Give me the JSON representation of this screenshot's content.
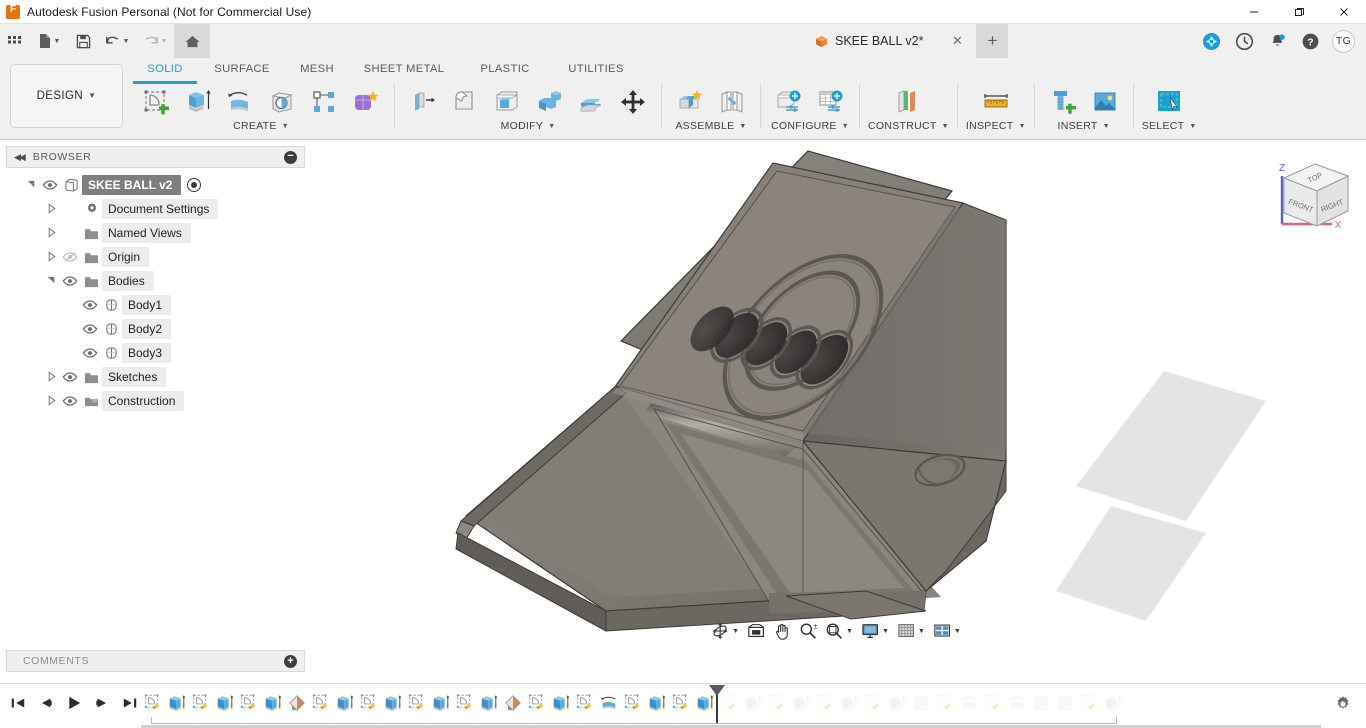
{
  "window": {
    "title": "Autodesk Fusion Personal (Not for Commercial Use)",
    "logo_icon": "fusion-logo-icon",
    "minimize_label": "—",
    "maximize_label": "❐",
    "close_label": "✕"
  },
  "quick_access": {
    "items": [
      {
        "name": "app-grid-button",
        "icon": "grid-icon"
      },
      {
        "name": "new-file-button",
        "icon": "file-icon",
        "has_caret": true
      },
      {
        "name": "save-button",
        "icon": "floppy-disk-icon"
      },
      {
        "name": "undo-button",
        "icon": "undo-arrow-icon",
        "has_caret": true
      },
      {
        "name": "redo-button",
        "icon": "redo-arrow-icon",
        "has_caret": true
      },
      {
        "name": "home-button",
        "icon": "home-icon"
      }
    ]
  },
  "document_tab": {
    "label": "SKEE BALL v2*",
    "icon": "orange-cube-icon",
    "close_label": "✕",
    "new_tab_label": "+"
  },
  "top_right": {
    "icons": [
      {
        "name": "extensions-icon",
        "glyph": "+",
        "color": "#1a9fd9"
      },
      {
        "name": "job-status-clock-icon",
        "glyph": "◴",
        "color": "#4d4d4d"
      },
      {
        "name": "notifications-bell-icon",
        "glyph": "🔔",
        "color": "#4d4d4d",
        "badge": true
      },
      {
        "name": "help-icon",
        "glyph": "?",
        "color": "#4d4d4d"
      }
    ],
    "avatar_initials": "TG"
  },
  "ribbon": {
    "workspace_label": "DESIGN",
    "workspace_caret": "▾",
    "tabs": [
      {
        "label": "SOLID",
        "active": true
      },
      {
        "label": "SURFACE",
        "active": false
      },
      {
        "label": "MESH",
        "active": false
      },
      {
        "label": "SHEET METAL",
        "active": false
      },
      {
        "label": "PLASTIC",
        "active": false
      },
      {
        "label": "UTILITIES",
        "active": false
      }
    ],
    "panels": [
      {
        "label": "CREATE",
        "has_caret": true,
        "tools": [
          {
            "name": "create-sketch-tool",
            "icon": "create-sketch-icon"
          },
          {
            "name": "extrude-tool",
            "icon": "extrude-icon"
          },
          {
            "name": "revolve-tool",
            "icon": "revolve-icon"
          },
          {
            "name": "hole-tool",
            "icon": "hole-icon"
          },
          {
            "name": "rectangular-pattern-tool",
            "icon": "pattern-icon"
          },
          {
            "name": "create-form-tool",
            "icon": "form-sculpt-icon"
          }
        ]
      },
      {
        "label": "MODIFY",
        "has_caret": true,
        "tools": [
          {
            "name": "press-pull-tool",
            "icon": "press-pull-icon"
          },
          {
            "name": "fillet-tool",
            "icon": "fillet-icon"
          },
          {
            "name": "shell-tool",
            "icon": "shell-icon"
          },
          {
            "name": "combine-tool",
            "icon": "combine-icon"
          },
          {
            "name": "offset-face-tool",
            "icon": "offset-face-icon"
          },
          {
            "name": "move-copy-tool",
            "icon": "move-copy-icon"
          }
        ]
      },
      {
        "label": "ASSEMBLE",
        "has_caret": true,
        "tools": [
          {
            "name": "new-component-tool",
            "icon": "new-component-icon"
          },
          {
            "name": "joint-tool",
            "icon": "joint-icon"
          }
        ]
      },
      {
        "label": "CONFIGURE",
        "has_caret": true,
        "tools": [
          {
            "name": "configure-design-tool",
            "icon": "configure-design-icon"
          },
          {
            "name": "configuration-table-tool",
            "icon": "configuration-table-icon"
          }
        ]
      },
      {
        "label": "CONSTRUCT",
        "has_caret": true,
        "tools": [
          {
            "name": "offset-plane-tool",
            "icon": "offset-plane-icon"
          }
        ]
      },
      {
        "label": "INSPECT",
        "has_caret": true,
        "tools": [
          {
            "name": "measure-tool",
            "icon": "measure-ruler-icon"
          }
        ]
      },
      {
        "label": "INSERT",
        "has_caret": true,
        "tools": [
          {
            "name": "insert-mcmaster-tool",
            "icon": "bolt-icon"
          },
          {
            "name": "insert-canvas-tool",
            "icon": "image-icon"
          }
        ]
      },
      {
        "label": "SELECT",
        "has_caret": true,
        "tools": [
          {
            "name": "select-tool",
            "icon": "select-window-icon"
          }
        ]
      }
    ]
  },
  "browser": {
    "header_label": "BROWSER",
    "collapse_icon": "double-left-chevron-icon",
    "minimize_icon": "minus-circle-icon",
    "tree": [
      {
        "label": "SKEE BALL v2",
        "arrow": "open",
        "indent": 0,
        "eye": "visible",
        "icon": "component-cube-icon",
        "selected": true,
        "has_activate_dot": true
      },
      {
        "label": "Document Settings",
        "arrow": "closed",
        "indent": 1,
        "eye": "none",
        "icon": "gear-icon",
        "selected": false
      },
      {
        "label": "Named Views",
        "arrow": "closed",
        "indent": 1,
        "eye": "none",
        "icon": "folder-icon",
        "selected": false
      },
      {
        "label": "Origin",
        "arrow": "closed",
        "indent": 1,
        "eye": "hidden",
        "icon": "folder-icon",
        "selected": false
      },
      {
        "label": "Bodies",
        "arrow": "open",
        "indent": 1,
        "eye": "visible",
        "icon": "folder-icon",
        "selected": false
      },
      {
        "label": "Body1",
        "arrow": "none",
        "indent": 2,
        "eye": "visible",
        "icon": "body-icon",
        "selected": false
      },
      {
        "label": "Body2",
        "arrow": "none",
        "indent": 2,
        "eye": "visible",
        "icon": "body-icon",
        "selected": false
      },
      {
        "label": "Body3",
        "arrow": "none",
        "indent": 2,
        "eye": "visible",
        "icon": "body-icon",
        "selected": false
      },
      {
        "label": "Sketches",
        "arrow": "closed",
        "indent": 1,
        "eye": "visible",
        "icon": "folder-icon",
        "selected": false
      },
      {
        "label": "Construction",
        "arrow": "closed",
        "indent": 1,
        "eye": "visible",
        "icon": "construction-folder-icon",
        "selected": false
      }
    ]
  },
  "canvas": {
    "model_name": "skee-ball-model",
    "background_color": "#ffffff",
    "viewcube": {
      "faces": [
        "TOP",
        "FRONT",
        "RIGHT"
      ],
      "axis_labels": [
        "Z",
        "X"
      ],
      "z_color": "#5b5bd6",
      "x_color": "#e0607e"
    },
    "navbar": [
      {
        "name": "orbit-button",
        "icon": "orbit-icon",
        "has_caret": true
      },
      {
        "name": "look-at-button",
        "icon": "look-at-icon",
        "has_caret": false
      },
      {
        "name": "pan-button",
        "icon": "pan-hand-icon",
        "has_caret": false
      },
      {
        "name": "zoom-button",
        "icon": "zoom-magnifier-icon",
        "has_caret": false
      },
      {
        "name": "fit-button",
        "icon": "fit-magnifier-icon",
        "has_caret": true
      },
      {
        "name": "display-settings-button",
        "icon": "monitor-icon",
        "has_caret": true
      },
      {
        "name": "grid-snaps-button",
        "icon": "grid-icon",
        "has_caret": true
      },
      {
        "name": "viewports-button",
        "icon": "viewports-icon",
        "has_caret": true
      }
    ]
  },
  "comments": {
    "label": "COMMENTS",
    "add_icon": "plus-circle-icon"
  },
  "timeline": {
    "playback": [
      {
        "name": "jump-to-beginning-button",
        "icon": "skip-back-icon"
      },
      {
        "name": "step-back-button",
        "icon": "step-back-icon"
      },
      {
        "name": "play-button",
        "icon": "play-icon"
      },
      {
        "name": "step-forward-button",
        "icon": "step-forward-icon"
      },
      {
        "name": "jump-to-end-button",
        "icon": "skip-forward-icon"
      }
    ],
    "settings_icon": "gear-icon",
    "marker_after_index": 24,
    "features": [
      {
        "icon": "sketch-icon"
      },
      {
        "icon": "extrude-icon"
      },
      {
        "icon": "sketch-icon"
      },
      {
        "icon": "extrude-icon"
      },
      {
        "icon": "sketch-icon"
      },
      {
        "icon": "extrude-icon"
      },
      {
        "icon": "appearance-icon"
      },
      {
        "icon": "sketch-icon"
      },
      {
        "icon": "extrude-icon"
      },
      {
        "icon": "sketch-icon"
      },
      {
        "icon": "extrude-icon"
      },
      {
        "icon": "sketch-icon"
      },
      {
        "icon": "extrude-icon"
      },
      {
        "icon": "sketch-icon"
      },
      {
        "icon": "extrude-icon"
      },
      {
        "icon": "appearance-icon"
      },
      {
        "icon": "sketch-icon"
      },
      {
        "icon": "extrude-icon"
      },
      {
        "icon": "sketch-icon"
      },
      {
        "icon": "revolve-icon"
      },
      {
        "icon": "sketch-icon"
      },
      {
        "icon": "extrude-icon"
      },
      {
        "icon": "sketch-icon"
      },
      {
        "icon": "extrude-icon"
      },
      {
        "icon": "sketch-icon"
      },
      {
        "icon": "extrude-icon"
      },
      {
        "icon": "sketch-icon"
      },
      {
        "icon": "extrude-icon"
      },
      {
        "icon": "sketch-icon"
      },
      {
        "icon": "extrude-icon"
      },
      {
        "icon": "sketch-icon"
      },
      {
        "icon": "extrude-icon"
      },
      {
        "icon": "fillet-icon"
      },
      {
        "icon": "sketch-icon"
      },
      {
        "icon": "revolve-icon"
      },
      {
        "icon": "sketch-icon"
      },
      {
        "icon": "revolve-icon"
      },
      {
        "icon": "fillet-icon"
      },
      {
        "icon": "fillet-icon"
      },
      {
        "icon": "sketch-icon"
      },
      {
        "icon": "extrude-icon"
      }
    ]
  }
}
